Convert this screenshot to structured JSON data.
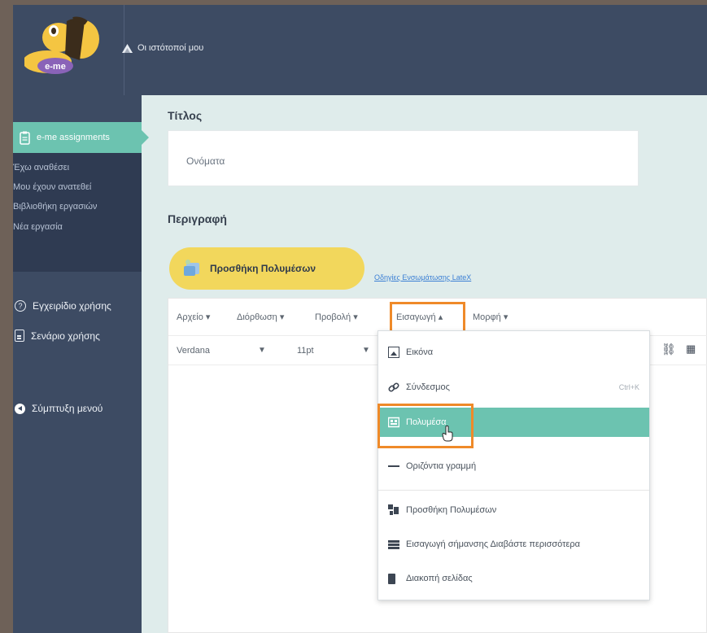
{
  "header": {
    "logo_text": "e-me",
    "sites_label": "Οι ιστότοποί μου"
  },
  "sidebar": {
    "active_item": "e-me assignments",
    "sub_items": [
      "Έχω αναθέσει",
      "Μου έχουν ανατεθεί",
      "Βιβλιοθήκη εργασιών",
      "Νέα εργασία"
    ],
    "items": [
      {
        "label": "Εγχειρίδιο χρήσης",
        "icon": "help-circle-icon"
      },
      {
        "label": "Σενάριο χρήσης",
        "icon": "document-icon"
      },
      {
        "label": "Σύμπτυξη μενού",
        "icon": "collapse-arrow-icon"
      }
    ]
  },
  "form": {
    "title_label": "Τίτλος",
    "title_value": "Ονόματα",
    "description_label": "Περιγραφή",
    "add_media_button": "Προσθήκη Πολυμέσων",
    "latex_link": "Οδηγίες Ενσωμάτωσης LateX"
  },
  "editor": {
    "menus": [
      "Αρχείο ▾",
      "Διόρθωση ▾",
      "Προβολή ▾",
      "Εισαγωγή ▴",
      "Μορφή ▾"
    ],
    "font_family": "Verdana",
    "font_size": "11pt"
  },
  "insert_menu": {
    "items": [
      {
        "label": "Εικόνα",
        "icon": "image-icon"
      },
      {
        "label": "Σύνδεσμος",
        "icon": "link-icon",
        "shortcut": "Ctrl+K"
      },
      {
        "label": "Πολυμέσα",
        "icon": "media-icon",
        "active": true
      },
      {
        "label": "Οριζόντια γραμμή",
        "icon": "horizontal-line-icon"
      },
      {
        "label": "Προσθήκη Πολυμέσων",
        "icon": "add-media-icon"
      },
      {
        "label": "Εισαγωγή σήμανσης Διαβάστε περισσότερα",
        "icon": "read-more-icon"
      },
      {
        "label": "Διακοπή σελίδας",
        "icon": "page-break-icon"
      }
    ]
  },
  "colors": {
    "header_bg": "#3d4b63",
    "accent": "#6cc3b0",
    "highlight": "#ef8a29",
    "button_yellow": "#f2d75c"
  }
}
